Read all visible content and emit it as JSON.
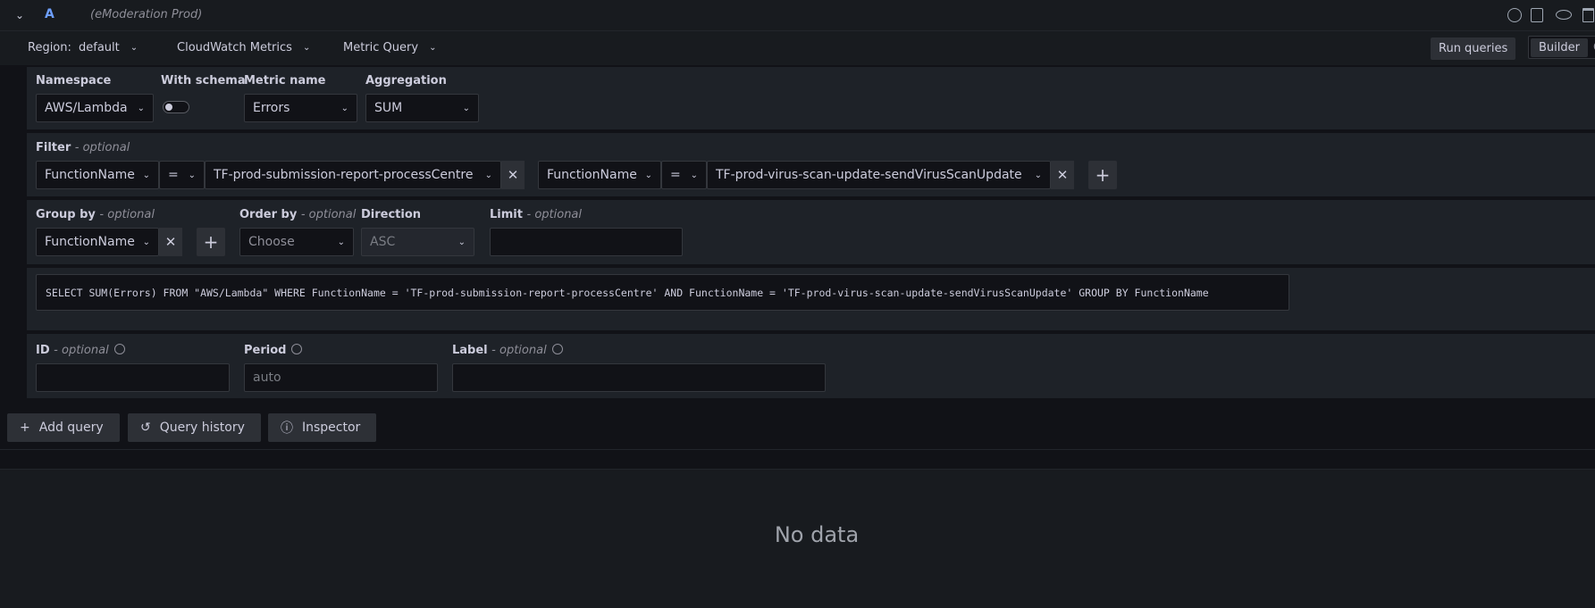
{
  "query": {
    "ref_id": "A",
    "datasource": "(eModeration Prod)"
  },
  "options": {
    "region_label": "Region:",
    "region_value": "default",
    "service": "CloudWatch Metrics",
    "mode": "Metric Query",
    "run_label": "Run queries",
    "builder_label": "Builder",
    "code_label": "C"
  },
  "metric": {
    "namespace_label": "Namespace",
    "namespace_value": "AWS/Lambda",
    "schema_label": "With schema",
    "metric_name_label": "Metric name",
    "metric_name_value": "Errors",
    "aggregation_label": "Aggregation",
    "aggregation_value": "SUM"
  },
  "filter": {
    "label": "Filter",
    "optional": "- optional",
    "items": [
      {
        "key": "FunctionName",
        "op": "=",
        "value": "TF-prod-submission-report-processCentre"
      },
      {
        "key": "FunctionName",
        "op": "=",
        "value": "TF-prod-virus-scan-update-sendVirusScanUpdate"
      }
    ]
  },
  "group": {
    "group_by_label": "Group by",
    "group_by_optional": "- optional",
    "group_by_value": "FunctionName",
    "order_by_label": "Order by",
    "order_by_optional": "- optional",
    "order_by_placeholder": "Choose",
    "direction_label": "Direction",
    "direction_value": "ASC",
    "limit_label": "Limit",
    "limit_optional": "- optional"
  },
  "sql": "SELECT SUM(Errors) FROM \"AWS/Lambda\" WHERE FunctionName = 'TF-prod-submission-report-processCentre' AND FunctionName = 'TF-prod-virus-scan-update-sendVirusScanUpdate' GROUP BY FunctionName",
  "fields": {
    "id_label": "ID",
    "id_optional": "- optional",
    "period_label": "Period",
    "period_placeholder": "auto",
    "label_label": "Label",
    "label_optional": "- optional"
  },
  "actions": {
    "add_query": "Add query",
    "query_history": "Query history",
    "inspector": "Inspector"
  },
  "result": {
    "empty_text": "No data"
  }
}
